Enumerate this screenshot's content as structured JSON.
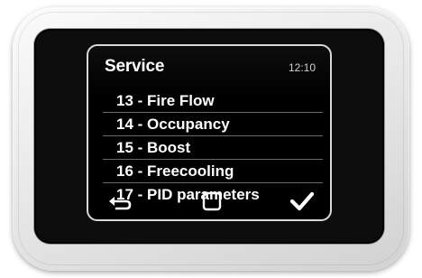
{
  "header": {
    "title": "Service",
    "time": "12:10"
  },
  "menu": {
    "items": [
      {
        "label": "13 - Fire Flow"
      },
      {
        "label": "14 - Occupancy"
      },
      {
        "label": "15 - Boost"
      },
      {
        "label": "16 - Freecooling"
      },
      {
        "label": "17 - PID parameters"
      }
    ]
  },
  "footer": {
    "back_icon": "back-arrow-icon",
    "home_icon": "square-home-icon",
    "confirm_icon": "checkmark-icon"
  },
  "colors": {
    "screen_background": "#000000",
    "text": "#ffffff",
    "device_body": "#e9e9e9",
    "bezel": "#0d0d0d"
  }
}
